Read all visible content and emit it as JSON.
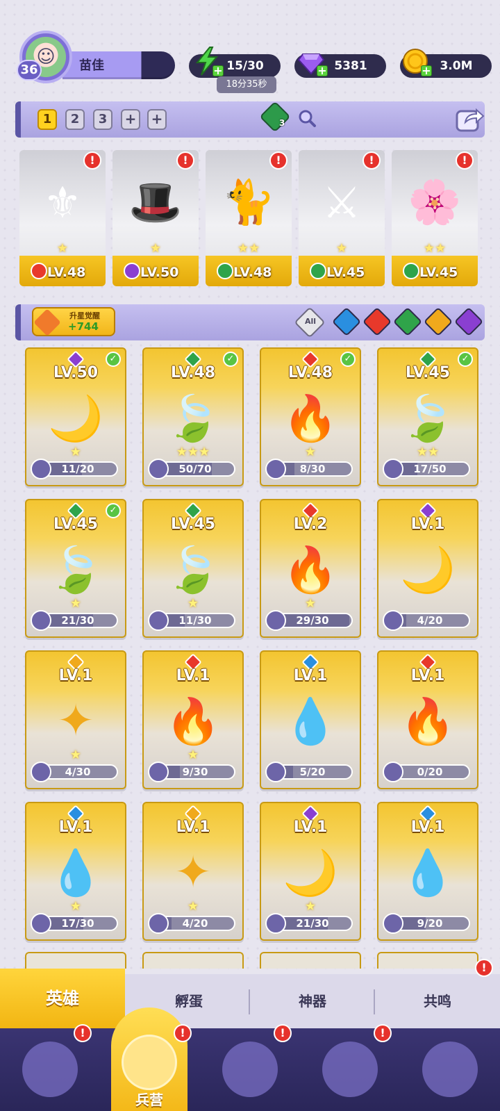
{
  "player": {
    "level": "36",
    "name": "苗佳"
  },
  "resources": {
    "energy": "15/30",
    "energy_timer": "18分35秒",
    "gems": "5381",
    "gold": "3.0M"
  },
  "teams": {
    "slots": [
      "1",
      "2",
      "3"
    ],
    "active_slot": "1",
    "element_badge_count": "3"
  },
  "team_heroes": [
    {
      "level": "LV.48",
      "element": "fire",
      "stars": "★",
      "icon": "holy-knight",
      "alert": true
    },
    {
      "level": "LV.50",
      "element": "dark",
      "stars": "★",
      "icon": "wizard-hat-ghost",
      "alert": true
    },
    {
      "level": "LV.48",
      "element": "nature",
      "stars": "★★",
      "icon": "cat-witch",
      "alert": true
    },
    {
      "level": "LV.45",
      "element": "nature",
      "stars": "★",
      "icon": "green-warrior",
      "alert": true
    },
    {
      "level": "LV.45",
      "element": "nature",
      "stars": "★★",
      "icon": "flower-girl",
      "alert": true
    }
  ],
  "filter": {
    "awaken_label": "升星觉醒",
    "awaken_value": "+744",
    "all_label": "All"
  },
  "heroes": [
    {
      "level": "LV.50",
      "element": "dark",
      "shards": "11/20",
      "progress": 0.55,
      "stars": "★",
      "checked": true
    },
    {
      "level": "LV.48",
      "element": "nature",
      "shards": "50/70",
      "progress": 0.71,
      "stars": "★★★",
      "checked": true
    },
    {
      "level": "LV.48",
      "element": "fire",
      "shards": "8/30",
      "progress": 0.27,
      "stars": "★",
      "checked": true
    },
    {
      "level": "LV.45",
      "element": "nature",
      "shards": "17/50",
      "progress": 0.34,
      "stars": "★★",
      "checked": true
    },
    {
      "level": "LV.45",
      "element": "nature",
      "shards": "21/30",
      "progress": 0.7,
      "stars": "★",
      "checked": true
    },
    {
      "level": "LV.45",
      "element": "nature",
      "shards": "11/30",
      "progress": 0.37,
      "stars": "★",
      "checked": false
    },
    {
      "level": "LV.2",
      "element": "fire",
      "shards": "29/30",
      "progress": 0.97,
      "stars": "★",
      "checked": false
    },
    {
      "level": "LV.1",
      "element": "dark",
      "shards": "4/20",
      "progress": 0.2,
      "stars": "",
      "checked": false
    },
    {
      "level": "LV.1",
      "element": "light",
      "shards": "4/30",
      "progress": 0.13,
      "stars": "★",
      "checked": false
    },
    {
      "level": "LV.1",
      "element": "fire",
      "shards": "9/30",
      "progress": 0.3,
      "stars": "★",
      "checked": false
    },
    {
      "level": "LV.1",
      "element": "water",
      "shards": "5/20",
      "progress": 0.25,
      "stars": "",
      "checked": false
    },
    {
      "level": "LV.1",
      "element": "fire",
      "shards": "0/20",
      "progress": 0.0,
      "stars": "",
      "checked": false
    },
    {
      "level": "LV.1",
      "element": "water",
      "shards": "17/30",
      "progress": 0.57,
      "stars": "★",
      "checked": false
    },
    {
      "level": "LV.1",
      "element": "light",
      "shards": "4/20",
      "progress": 0.2,
      "stars": "★",
      "checked": false
    },
    {
      "level": "LV.1",
      "element": "dark",
      "shards": "21/30",
      "progress": 0.7,
      "stars": "★",
      "checked": false
    },
    {
      "level": "LV.1",
      "element": "water",
      "shards": "9/20",
      "progress": 0.45,
      "stars": "",
      "checked": false
    }
  ],
  "sub_tabs": [
    "英雄",
    "孵蛋",
    "神器",
    "共鸣"
  ],
  "bottom_nav": {
    "active_label": "兵营"
  },
  "colors": {
    "fire": "#e8392b",
    "dark": "#8a3fd1",
    "nature": "#2fa44a",
    "water": "#2a8fe0",
    "light": "#f0a91c",
    "accent_gold": "#f4c21c",
    "panel_purple": "#aaa3e0"
  }
}
